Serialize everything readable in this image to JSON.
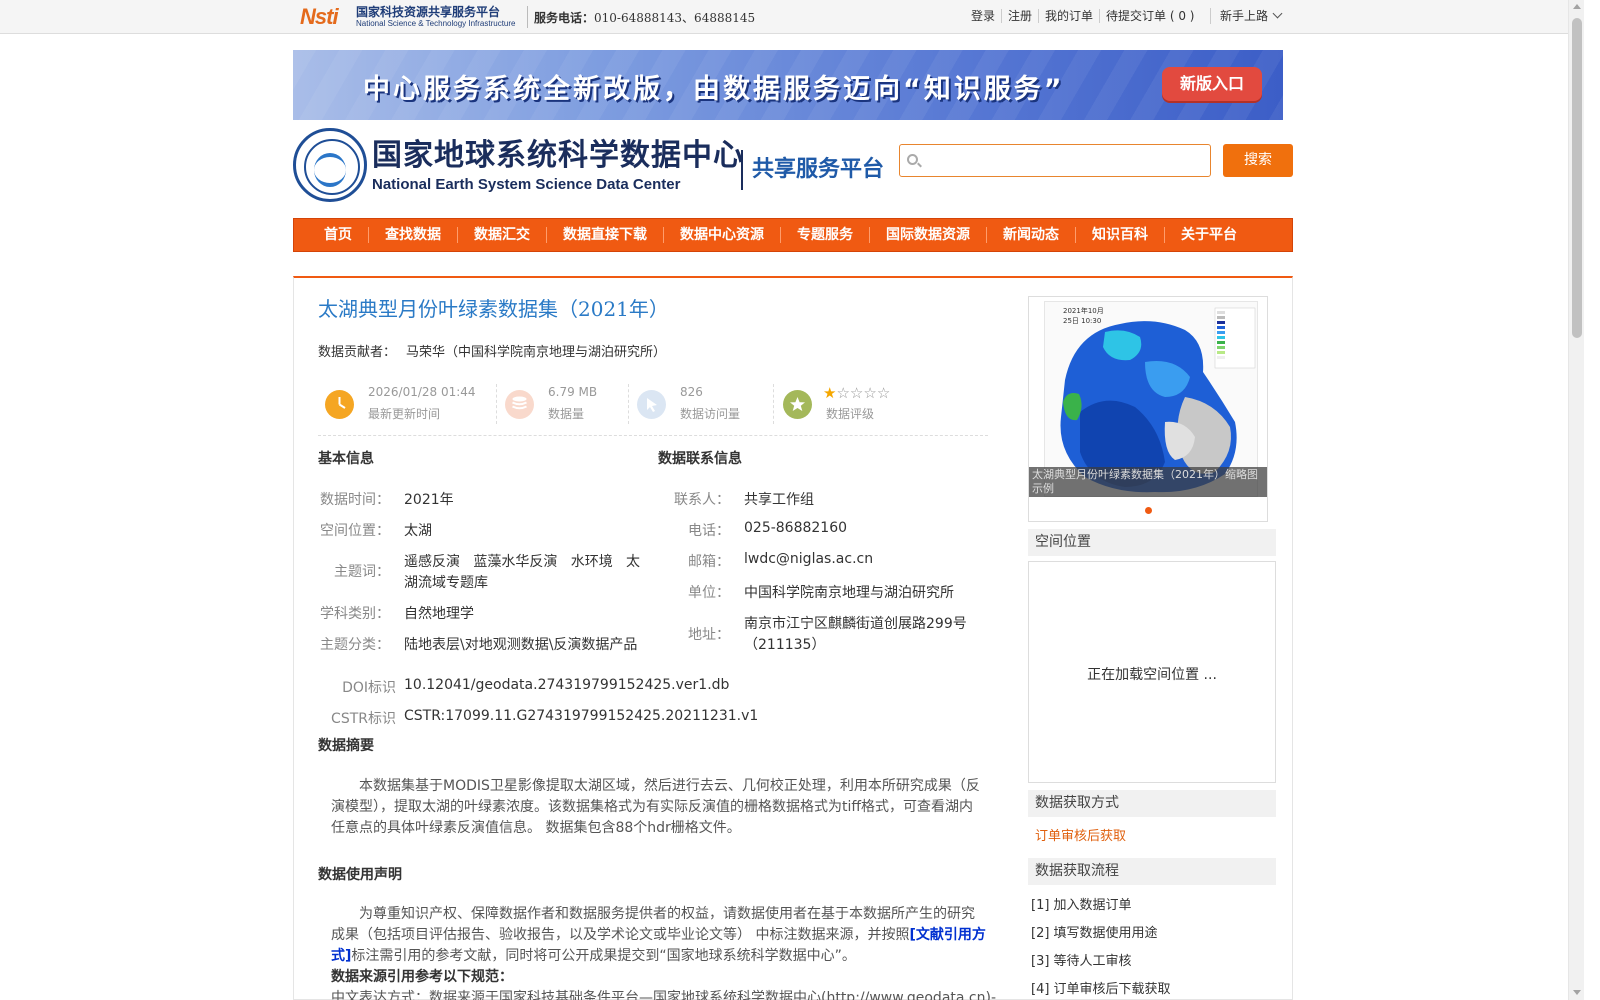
{
  "topbar": {
    "logo_mark": "Nsti",
    "logo_cn": "国家科技资源共享服务平台",
    "logo_en": "National Science & Technology Infrastructure",
    "hotline_label": "服务电话：",
    "hotline_value": "010-64888143、64888145",
    "links": [
      "登录",
      "注册",
      "我的订单",
      "待提交订单 ( 0 )"
    ],
    "guide": "新手上路"
  },
  "banner": {
    "text": "中心服务系统全新改版，由数据服务迈向“知识服务”",
    "button": "新版入口"
  },
  "header": {
    "name_cn": "国家地球系统科学数据中心",
    "name_en": "National Earth System Science Data Center",
    "platform": "共享服务平台",
    "search_placeholder": "",
    "search_button": "搜索"
  },
  "nav": [
    "首页",
    "查找数据",
    "数据汇交",
    "数据直接下载",
    "数据中心资源",
    "专题服务",
    "国际数据资源",
    "新闻动态",
    "知识百科",
    "关于平台"
  ],
  "dataset": {
    "title": "太湖典型月份叶绿素数据集（2021年）",
    "contributor_label": "数据贡献者：",
    "contributor": "马荣华（中国科学院南京地理与湖泊研究所）",
    "stats": {
      "updated_value": "2026/01/28 01:44",
      "updated_label": "最新更新时间",
      "size_value": "6.79 MB",
      "size_label": "数据量",
      "visits_value": "826",
      "visits_label": "数据访问量",
      "rating_label": "数据评级",
      "rating": 1,
      "rating_max": 5
    },
    "basic": {
      "heading": "基本信息",
      "time_label": "数据时间：",
      "time": "2021年",
      "space_label": "空间位置：",
      "space": "太湖",
      "keywords_label": "主题词：",
      "keywords_line1": "遥感反演   蓝藻水华反演   水环境   太",
      "keywords_line2": "湖流域专题库",
      "discipline_label": "学科类别：",
      "discipline": "自然地理学",
      "category_label": "主题分类：",
      "category": "陆地表层\\对地观测数据\\反演数据产品",
      "doi_label": "DOI标识",
      "doi": "10.12041/geodata.274319799152425.ver1.db",
      "cstr_label": "CSTR标识",
      "cstr": "CSTR:17099.11.G274319799152425.20211231.v1"
    },
    "contact": {
      "heading": "数据联系信息",
      "person_label": "联系人：",
      "person": "共享工作组",
      "phone_label": "电话：",
      "phone": "025-86882160",
      "email_label": "邮箱：",
      "email": "lwdc@niglas.ac.cn",
      "org_label": "单位：",
      "org": "中国科学院南京地理与湖泊研究所",
      "addr_label": "地址：",
      "addr_line1": "南京市江宁区麒麟街道创展路299号",
      "addr_line2": "（211135）"
    },
    "abstract": {
      "heading": "数据摘要",
      "line1": "本数据集基于MODIS卫星影像提取太湖区域，然后进行去云、几何校正处理，利用本所研究成果（反",
      "line2": "演模型），提取太湖的叶绿素浓度。该数据集格式为有实际反演值的栅格数据格式为tiff格式，可查看湖内",
      "line3": "任意点的具体叶绿素反演值信息。 数据集包含88个hdr栅格文件。"
    },
    "usage": {
      "heading": "数据使用声明",
      "line1": "为尊重知识产权、保障数据作者和数据服务提供者的权益，请数据使用者在基于本数据所产生的研究",
      "line2_pre": "成果（包括项目评估报告、验收报告，以及学术论文或毕业论文等） 中标注数据来源，并按照",
      "link": "[文献引用方",
      "line3_link": "式]",
      "line3_post": "标注需引用的参考文献，同时将可公开成果提交到“国家地球系统科学数据中心”。",
      "sub_heading": "数据来源引用参考以下规范：",
      "line4": "中文表达方式：数据来源于国家科技基础条件平台—国家地球系统科学数据中心(http://www.geodata.cn)-"
    }
  },
  "sidebar": {
    "thumb_legend_title": "2021年10月25日 10:30",
    "thumb_caption": "太湖典型月份叶绿素数据集（2021年）缩略图示例",
    "location_heading": "空间位置",
    "location_loading": "正在加载空间位置 ...",
    "access_heading": "数据获取方式",
    "access_method": "订单审核后获取",
    "flow_heading": "数据获取流程",
    "steps": [
      "[1] 加入数据订单",
      "[2] 填写数据使用用途",
      "[3] 等待人工审核",
      "[4] 订单审核后下载获取"
    ]
  },
  "colors": {
    "accent": "#f05a12",
    "title": "#2a7ac6",
    "link": "#e0600e"
  }
}
